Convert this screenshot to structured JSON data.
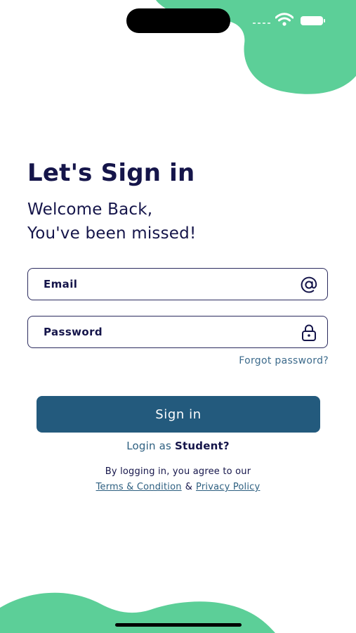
{
  "colors": {
    "accent_green": "#5ccf98",
    "primary_button": "#235a7d",
    "title_navy": "#15154a",
    "link_blue": "#2d5f80"
  },
  "status_bar": {
    "icons": [
      "wifi-icon",
      "battery-icon"
    ]
  },
  "header": {
    "title": "Let's Sign in",
    "subtitle_line1": "Welcome Back,",
    "subtitle_line2": "You've been missed!"
  },
  "form": {
    "email": {
      "placeholder": "Email",
      "value": "",
      "icon": "at-sign-icon"
    },
    "password": {
      "placeholder": "Password",
      "value": "",
      "icon": "lock-icon"
    },
    "forgot_label": "Forgot password?",
    "signin_label": "Sign in"
  },
  "login_as": {
    "prefix": "Login as ",
    "role_link": "Student?"
  },
  "legal": {
    "agree_text": "By logging in, you agree to our",
    "terms_link": "Terms & Condition",
    "separator": "&",
    "privacy_link": "Privacy Policy"
  }
}
